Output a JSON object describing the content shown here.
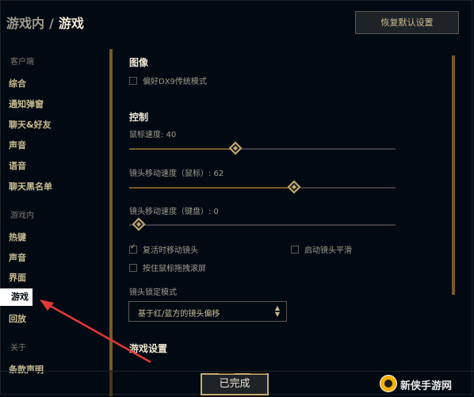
{
  "breadcrumb": {
    "parent": "游戏内",
    "separator": "/",
    "current": "游戏"
  },
  "header": {
    "reset_label": "恢复默认设置"
  },
  "nav": {
    "groups": [
      {
        "label": "客户端",
        "items": [
          "综合",
          "通知弹窗",
          "聊天&好友",
          "声音",
          "语音",
          "聊天黑名单"
        ]
      },
      {
        "label": "游戏内",
        "items": [
          "热键",
          "声音",
          "界面",
          "游戏",
          "回放"
        ]
      },
      {
        "label": "关于",
        "items": [
          "条款声明"
        ]
      }
    ],
    "active": "游戏"
  },
  "sections": {
    "image": {
      "title": "图像",
      "dx9": {
        "label": "偏好DX9传统模式",
        "checked": false
      }
    },
    "control": {
      "title": "控制",
      "mouse_speed": {
        "label": "鼠标速度: 40",
        "value": 40
      },
      "camera_mouse": {
        "label": "镜头移动速度（鼠标）: 62",
        "value": 62
      },
      "camera_keyboard": {
        "label": "镜头移动速度（键盘）: 0",
        "value": 0
      },
      "respawn_move": {
        "label": "复活时移动镜头",
        "checked": true
      },
      "smooth_camera": {
        "label": "启动镜头平滑",
        "checked": false
      },
      "drag_scroll": {
        "label": "按住鼠标拖拽滚屏",
        "checked": false
      },
      "camera_lock_label": "镜头锁定模式",
      "camera_lock_value": "基于红/蓝方的镜头偏移"
    },
    "game": {
      "title": "游戏设置"
    }
  },
  "footer": {
    "done_label": "已完成"
  },
  "watermark": {
    "text": "新侠手游网"
  },
  "colors": {
    "gold": "#c8aa6e",
    "arrow": "#e53935",
    "bg": "#010a13"
  }
}
